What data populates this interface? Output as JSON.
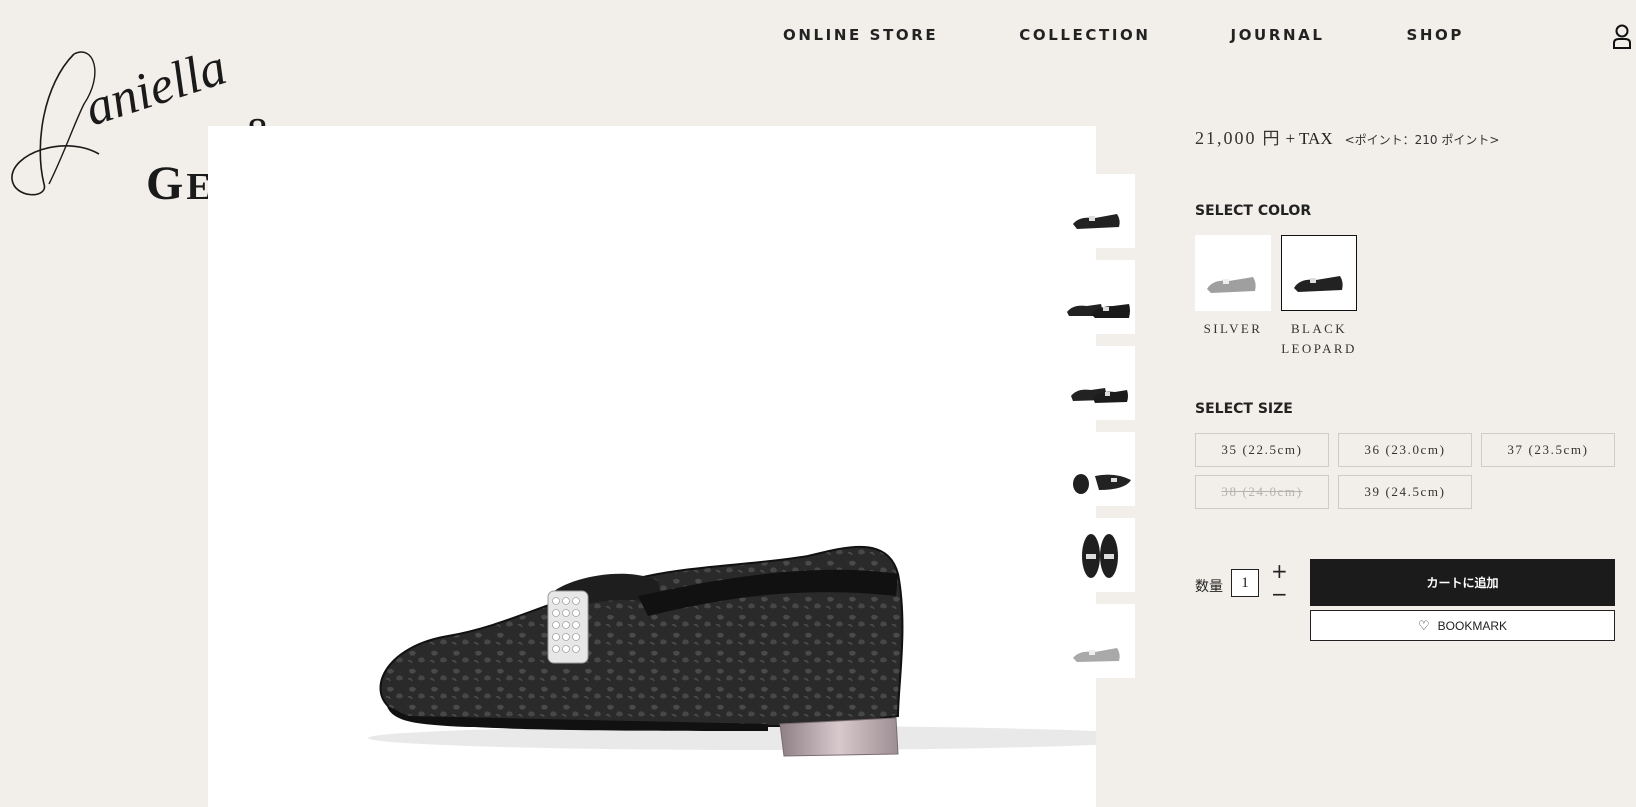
{
  "brand": {
    "script": "Daniella",
    "amp": "&",
    "word_first": "G",
    "word_rest": "EMMA"
  },
  "nav": {
    "items": [
      "ONLINE STORE",
      "COLLECTION",
      "JOURNAL",
      "SHOP"
    ],
    "user_icon": "user-icon"
  },
  "product": {
    "price": "21,000",
    "currency": "円",
    "tax": "+ TAX",
    "points": "<ポイント：210 ポイント>",
    "color_title": "SELECT COLOR",
    "colors": [
      {
        "label": "SILVER",
        "selected": false
      },
      {
        "label": "BLACK LEOPARD",
        "selected": true
      }
    ],
    "size_title": "SELECT SIZE",
    "sizes": [
      {
        "label": "35 (22.5cm)",
        "available": true
      },
      {
        "label": "36 (23.0cm)",
        "available": true
      },
      {
        "label": "37 (23.5cm)",
        "available": true
      },
      {
        "label": "38 (24.0cm)",
        "available": false
      },
      {
        "label": "39 (24.5cm)",
        "available": true
      }
    ],
    "quantity_label": "数量",
    "quantity": "1",
    "plus": "+",
    "minus": "−",
    "cart_label": "カートに追加",
    "bookmark_label": "BOOKMARK",
    "bookmark_icon": "heart-icon"
  },
  "colors": {
    "background": "#f2efea",
    "button_dark": "#1b1b1b",
    "text": "#1a1a1a"
  }
}
